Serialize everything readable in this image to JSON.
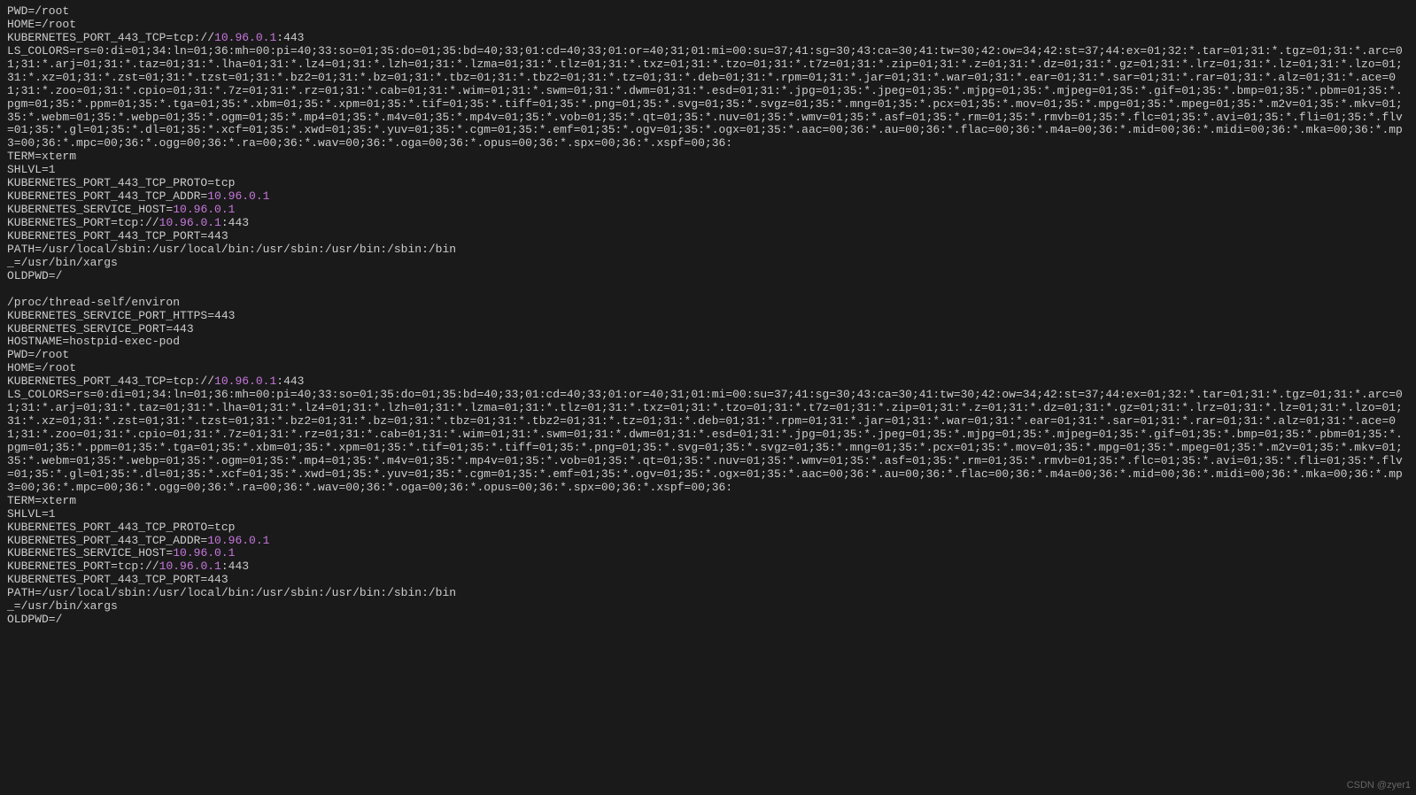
{
  "env": {
    "PWD": "PWD=/root",
    "HOME": "HOME=/root",
    "K8S_443_TCP_pre": "KUBERNETES_PORT_443_TCP=tcp://",
    "K8S_443_TCP_ip": "10.96.0.1",
    "K8S_443_TCP_post": ":443",
    "LS_COLORS": "LS_COLORS=rs=0:di=01;34:ln=01;36:mh=00:pi=40;33:so=01;35:do=01;35:bd=40;33;01:cd=40;33;01:or=40;31;01:mi=00:su=37;41:sg=30;43:ca=30;41:tw=30;42:ow=34;42:st=37;44:ex=01;32:*.tar=01;31:*.tgz=01;31:*.arc=01;31:*.arj=01;31:*.taz=01;31:*.lha=01;31:*.lz4=01;31:*.lzh=01;31:*.lzma=01;31:*.tlz=01;31:*.txz=01;31:*.tzo=01;31:*.t7z=01;31:*.zip=01;31:*.z=01;31:*.dz=01;31:*.gz=01;31:*.lrz=01;31:*.lz=01;31:*.lzo=01;31:*.xz=01;31:*.zst=01;31:*.tzst=01;31:*.bz2=01;31:*.bz=01;31:*.tbz=01;31:*.tbz2=01;31:*.tz=01;31:*.deb=01;31:*.rpm=01;31:*.jar=01;31:*.war=01;31:*.ear=01;31:*.sar=01;31:*.rar=01;31:*.alz=01;31:*.ace=01;31:*.zoo=01;31:*.cpio=01;31:*.7z=01;31:*.rz=01;31:*.cab=01;31:*.wim=01;31:*.swm=01;31:*.dwm=01;31:*.esd=01;31:*.jpg=01;35:*.jpeg=01;35:*.mjpg=01;35:*.mjpeg=01;35:*.gif=01;35:*.bmp=01;35:*.pbm=01;35:*.pgm=01;35:*.ppm=01;35:*.tga=01;35:*.xbm=01;35:*.xpm=01;35:*.tif=01;35:*.tiff=01;35:*.png=01;35:*.svg=01;35:*.svgz=01;35:*.mng=01;35:*.pcx=01;35:*.mov=01;35:*.mpg=01;35:*.mpeg=01;35:*.m2v=01;35:*.mkv=01;35:*.webm=01;35:*.webp=01;35:*.ogm=01;35:*.mp4=01;35:*.m4v=01;35:*.mp4v=01;35:*.vob=01;35:*.qt=01;35:*.nuv=01;35:*.wmv=01;35:*.asf=01;35:*.rm=01;35:*.rmvb=01;35:*.flc=01;35:*.avi=01;35:*.fli=01;35:*.flv=01;35:*.gl=01;35:*.dl=01;35:*.xcf=01;35:*.xwd=01;35:*.yuv=01;35:*.cgm=01;35:*.emf=01;35:*.ogv=01;35:*.ogx=01;35:*.aac=00;36:*.au=00;36:*.flac=00;36:*.m4a=00;36:*.mid=00;36:*.midi=00;36:*.mka=00;36:*.mp3=00;36:*.mpc=00;36:*.ogg=00;36:*.ra=00;36:*.wav=00;36:*.oga=00;36:*.opus=00;36:*.spx=00;36:*.xspf=00;36:",
    "TERM": "TERM=xterm",
    "SHLVL": "SHLVL=1",
    "K8S_443_PROTO": "KUBERNETES_PORT_443_TCP_PROTO=tcp",
    "K8S_443_ADDR_pre": "KUBERNETES_PORT_443_TCP_ADDR=",
    "K8S_443_ADDR_ip": "10.96.0.1",
    "K8S_SVC_HOST_pre": "KUBERNETES_SERVICE_HOST=",
    "K8S_SVC_HOST_ip": "10.96.0.1",
    "K8S_PORT_pre": "KUBERNETES_PORT=tcp://",
    "K8S_PORT_ip": "10.96.0.1",
    "K8S_PORT_post": ":443",
    "K8S_443_PORT": "KUBERNETES_PORT_443_TCP_PORT=443",
    "PATH": "PATH=/usr/local/sbin:/usr/local/bin:/usr/sbin:/usr/bin:/sbin:/bin",
    "UNDERSCORE": "_=/usr/bin/xargs",
    "OLDPWD": "OLDPWD=/"
  },
  "sep": {
    "blank": "",
    "proc": "/proc/thread-self/environ",
    "SVC_PORT_HTTPS": "KUBERNETES_SERVICE_PORT_HTTPS=443",
    "SVC_PORT": "KUBERNETES_SERVICE_PORT=443",
    "HOSTNAME": "HOSTNAME=hostpid-exec-pod"
  },
  "watermark": "CSDN @zyer1"
}
